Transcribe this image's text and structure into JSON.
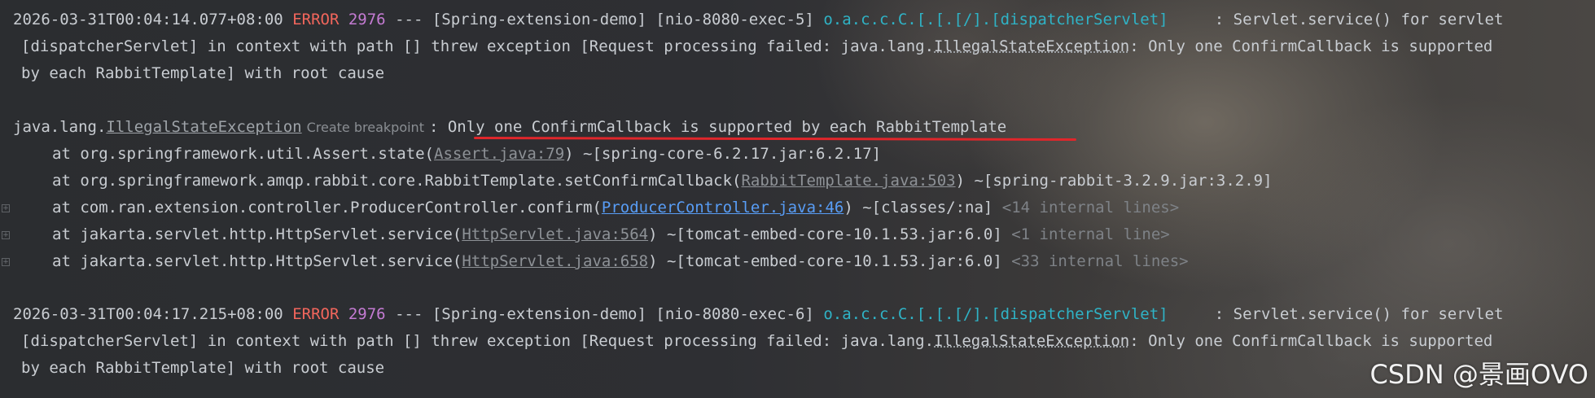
{
  "log1": {
    "timestamp": "2026-03-31T00:04:14.077+08:00",
    "level": "ERROR",
    "pid": "2976",
    "sep": "---",
    "app": "[Spring-extension-demo]",
    "thread": "[nio-8080-exec-5]",
    "logger": "o.a.c.c.C.[.[.[/].[dispatcherServlet]",
    "msg_head": ": Servlet.service() for servlet",
    "line2_pre": "[dispatcherServlet] in context with path [] threw exception [Request processing failed: java.lang.",
    "line2_exc": "IllegalStateException",
    "line2_post": ": Only one ConfirmCallback is supported",
    "line3": "by each RabbitTemplate] with root cause"
  },
  "exception": {
    "pkg": "java.lang.",
    "name": "IllegalStateException",
    "breakpoint_hint": "Create breakpoint",
    "colon": ": ",
    "message": "Only one ConfirmCallback is supported by each RabbitTemplate"
  },
  "frames": [
    {
      "method": "at org.springframework.util.Assert.state(",
      "source": "Assert.java:79",
      "after": ") ~[spring-core-6.2.17.jar:6.2.17]",
      "internal": "",
      "expandable": false,
      "active": false
    },
    {
      "method": "at org.springframework.amqp.rabbit.core.RabbitTemplate.setConfirmCallback(",
      "source": "RabbitTemplate.java:503",
      "after": ") ~[spring-rabbit-3.2.9.jar:3.2.9]",
      "internal": "",
      "expandable": false,
      "active": false
    },
    {
      "method": "at com.ran.extension.controller.ProducerController.confirm(",
      "source": "ProducerController.java:46",
      "after": ") ~[classes/:na] ",
      "internal": "<14 internal lines>",
      "expandable": true,
      "active": true
    },
    {
      "method": "at jakarta.servlet.http.HttpServlet.service(",
      "source": "HttpServlet.java:564",
      "after": ") ~[tomcat-embed-core-10.1.53.jar:6.0] ",
      "internal": "<1 internal line>",
      "expandable": true,
      "active": false
    },
    {
      "method": "at jakarta.servlet.http.HttpServlet.service(",
      "source": "HttpServlet.java:658",
      "after": ") ~[tomcat-embed-core-10.1.53.jar:6.0] ",
      "internal": "<33 internal lines>",
      "expandable": true,
      "active": false
    }
  ],
  "log2": {
    "timestamp": "2026-03-31T00:04:17.215+08:00",
    "level": "ERROR",
    "pid": "2976",
    "sep": "---",
    "app": "[Spring-extension-demo]",
    "thread": "[nio-8080-exec-6]",
    "logger": "o.a.c.c.C.[.[.[/].[dispatcherServlet]",
    "msg_head": ": Servlet.service() for servlet",
    "line2_pre": "[dispatcherServlet] in context with path [] threw exception [Request processing failed: java.lang.",
    "line2_exc": "IllegalStateException",
    "line2_post": ": Only one ConfirmCallback is supported",
    "line3": "by each RabbitTemplate] with root cause"
  },
  "gutter": {
    "expand_glyph": "+"
  },
  "watermark": "CSDN @景画OVO",
  "colors": {
    "error": "#f2665c",
    "pid": "#c47bd3",
    "logger": "#2fb3c6",
    "link": "#589df6",
    "annotation_underline": "#e0262b"
  }
}
